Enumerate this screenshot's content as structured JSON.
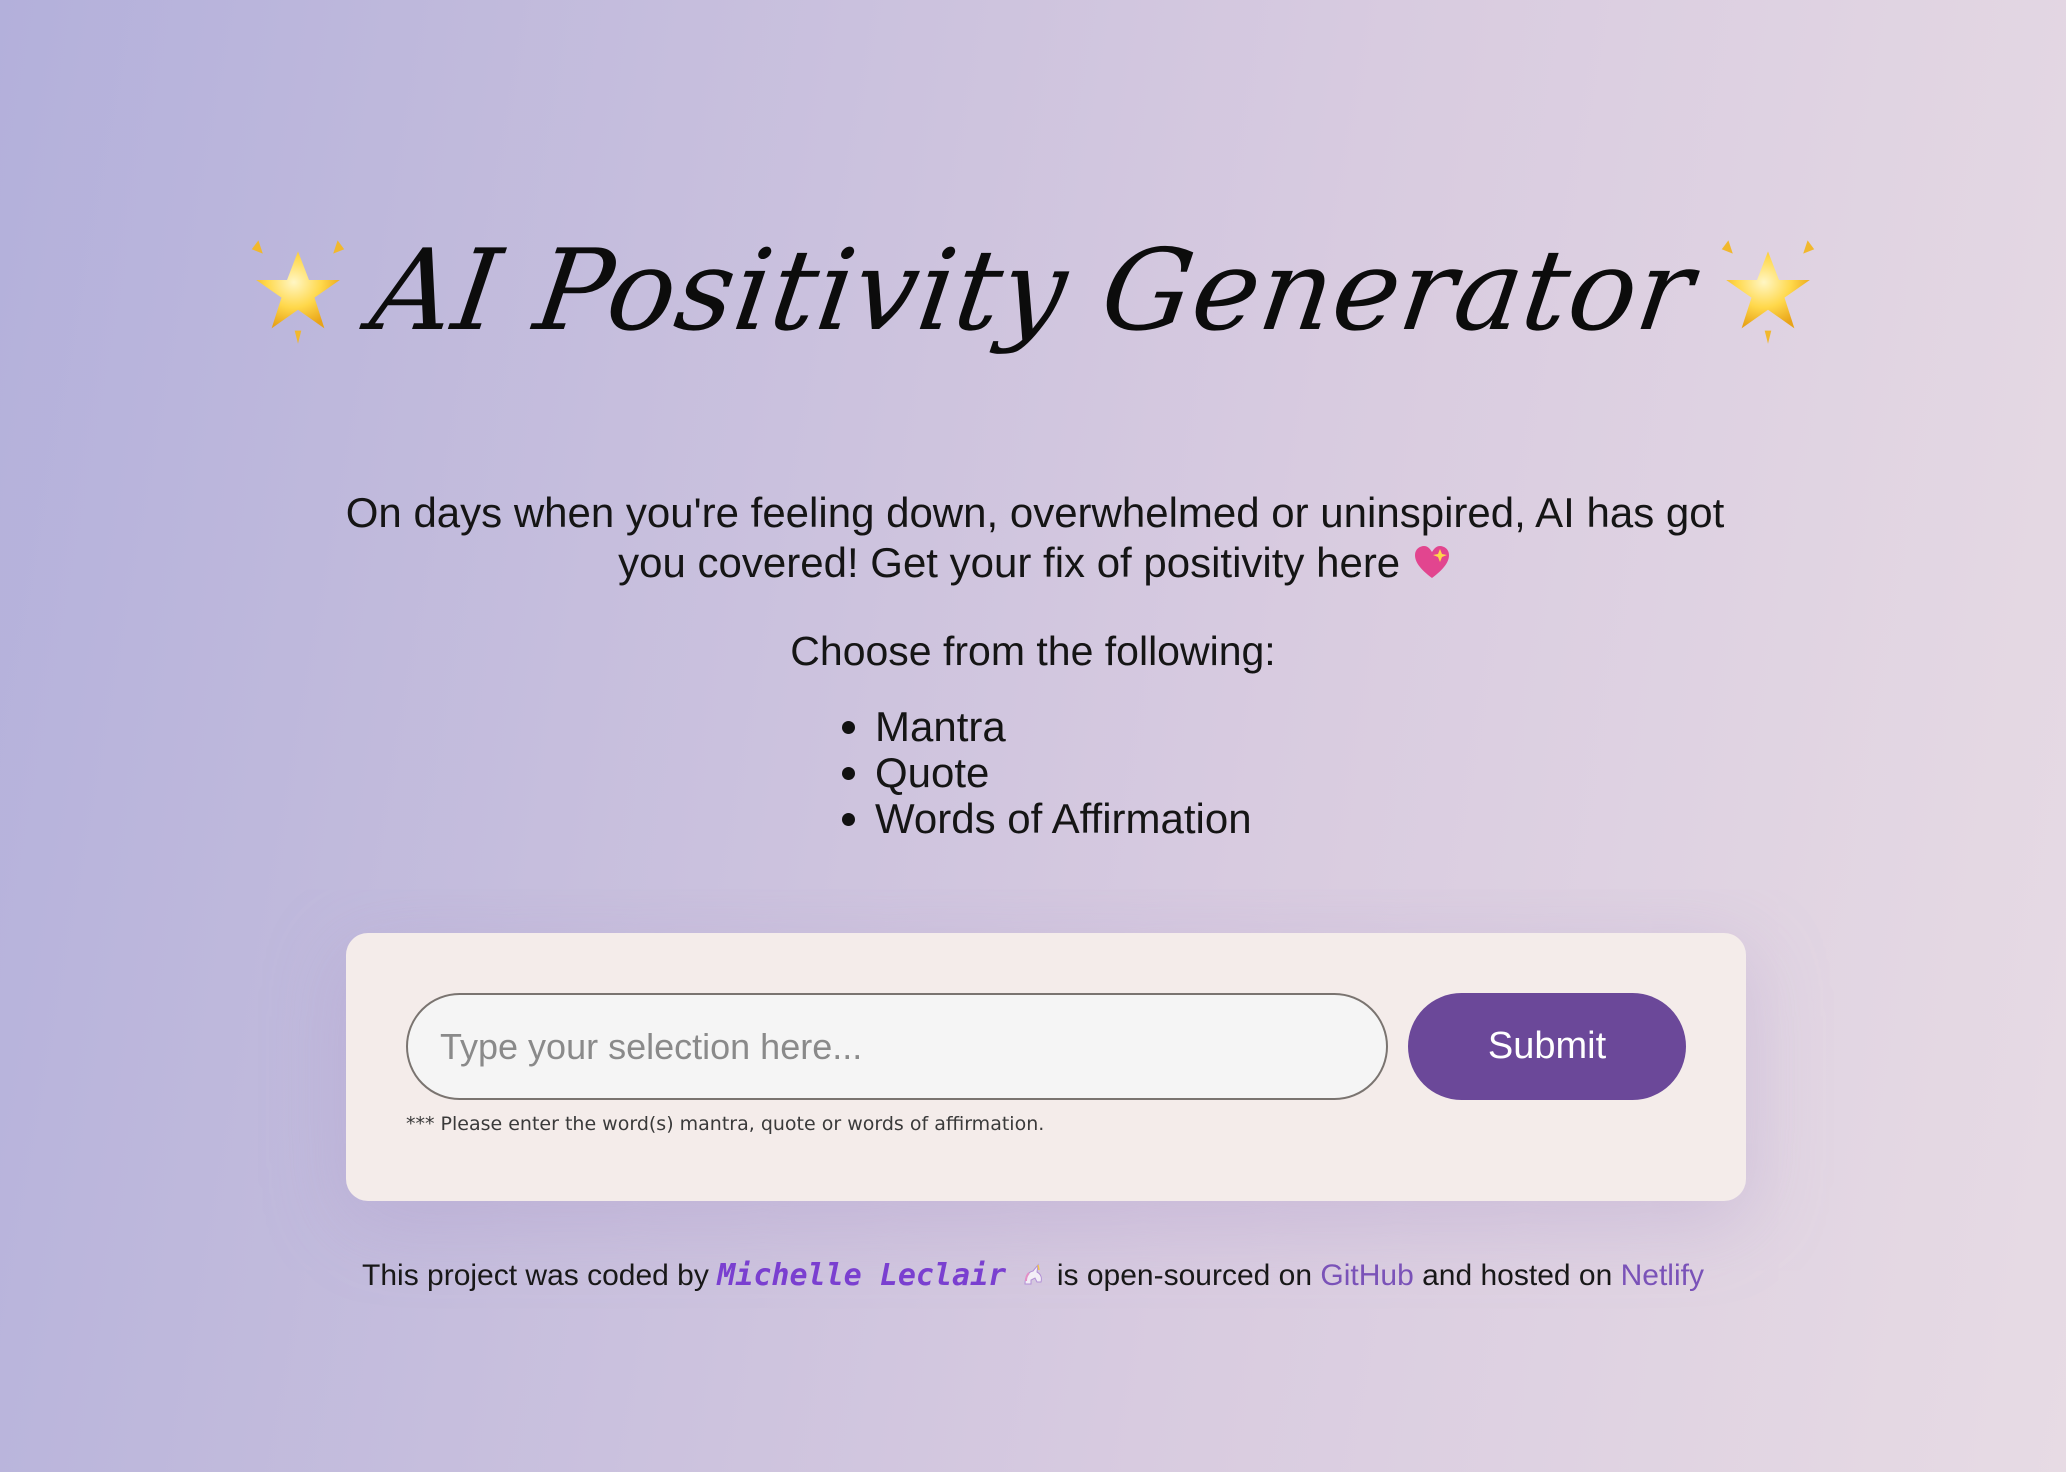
{
  "header": {
    "title": "AI Positivity Generator",
    "left_icon": "sparkling-star-icon",
    "right_icon": "sparkling-star-icon"
  },
  "intro": {
    "text": "On days when you're feeling down, overwhelmed or uninspired, AI has got you covered! Get your fix of positivity here",
    "icon": "sparkling-heart-icon",
    "choose_text": "Choose from the following:",
    "options": [
      "Mantra",
      "Quote",
      "Words of Affirmation"
    ]
  },
  "form": {
    "input_placeholder": "Type your selection here...",
    "submit_label": "Submit",
    "hint": "*** Please enter the word(s) mantra, quote or words of affirmation."
  },
  "footer": {
    "prefix": "This project was coded by",
    "author": "Michelle Leclair",
    "author_icon": "unicorn-icon",
    "middle": "is open-sourced on",
    "github_label": "GitHub",
    "and_text": "and hosted on",
    "netlify_label": "Netlify"
  },
  "colors": {
    "accent": "#6b4899",
    "author": "#7a3fd0",
    "link": "#7a52b8",
    "card": "#f4ecea"
  }
}
